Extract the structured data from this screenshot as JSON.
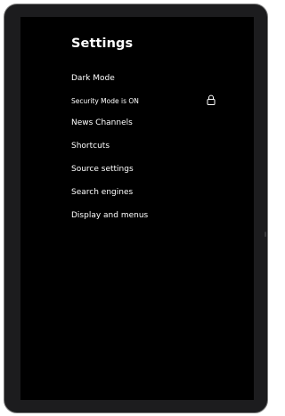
{
  "settings": {
    "title": "Settings",
    "items": [
      {
        "label": "Dark Mode"
      },
      {
        "label": "Security Mode is ON",
        "icon": "lock-icon"
      },
      {
        "label": "News Channels"
      },
      {
        "label": "Shortcuts"
      },
      {
        "label": "Source settings"
      },
      {
        "label": "Search engines"
      },
      {
        "label": "Display and menus"
      }
    ]
  },
  "colors": {
    "background": "#000000",
    "text": "#ffffff",
    "frame": "#1c1c1e"
  }
}
